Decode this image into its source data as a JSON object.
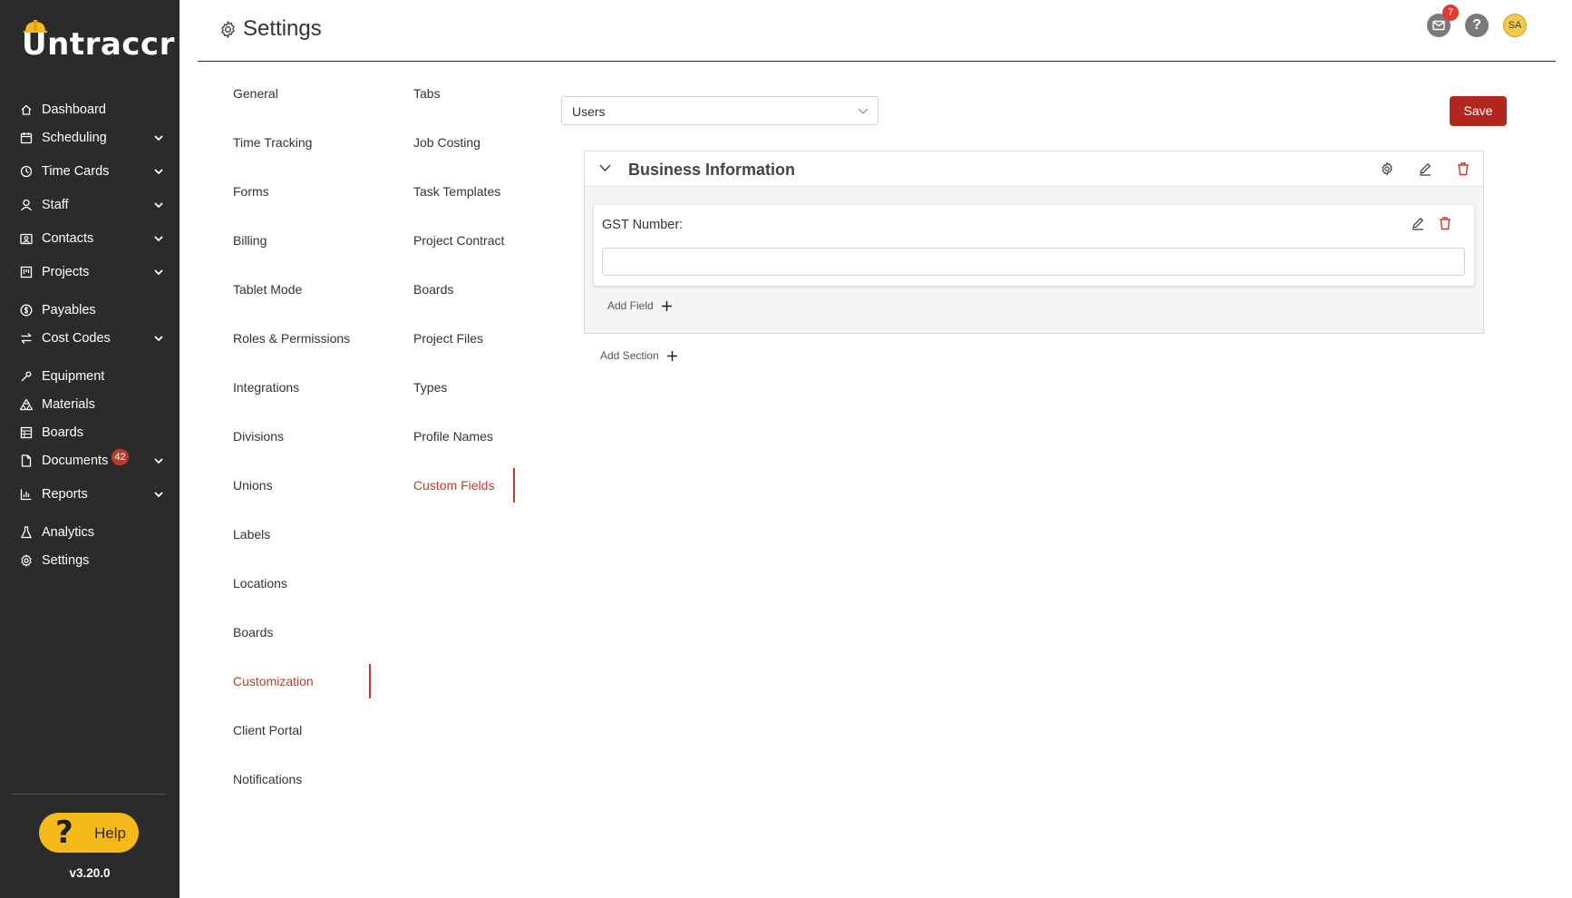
{
  "app": {
    "logo_text": "Untraccr",
    "version": "v3.20.0",
    "help_label": "Help"
  },
  "sidebar": {
    "items": [
      {
        "label": "Dashboard",
        "icon": "home-icon",
        "chevron": false
      },
      {
        "label": "Scheduling",
        "icon": "calendar-icon",
        "chevron": true
      },
      {
        "label": "Time Cards",
        "icon": "clock-icon",
        "chevron": true
      },
      {
        "label": "Staff",
        "icon": "user-icon",
        "chevron": true
      },
      {
        "label": "Contacts",
        "icon": "contacts-icon",
        "chevron": true
      },
      {
        "label": "Projects",
        "icon": "projects-icon",
        "chevron": true
      },
      {
        "label": "Payables",
        "icon": "dollar-icon",
        "chevron": false
      },
      {
        "label": "Cost Codes",
        "icon": "swap-icon",
        "chevron": true
      },
      {
        "label": "Equipment",
        "icon": "wrench-icon",
        "chevron": false
      },
      {
        "label": "Materials",
        "icon": "materials-icon",
        "chevron": false
      },
      {
        "label": "Boards",
        "icon": "board-icon",
        "chevron": false
      },
      {
        "label": "Documents",
        "icon": "document-icon",
        "chevron": true,
        "badge": "42"
      },
      {
        "label": "Reports",
        "icon": "bar-chart-icon",
        "chevron": true
      },
      {
        "label": "Analytics",
        "icon": "flask-icon",
        "chevron": false
      },
      {
        "label": "Settings",
        "icon": "gear-icon",
        "chevron": false
      }
    ]
  },
  "header": {
    "title": "Settings",
    "mail_badge": "7",
    "help_glyph": "?",
    "avatar_initials": "SA"
  },
  "settings_nav": {
    "column1": [
      "General",
      "Time Tracking",
      "Forms",
      "Billing",
      "Tablet Mode",
      "Roles & Permissions",
      "Integrations",
      "Divisions",
      "Unions",
      "Labels",
      "Locations",
      "Boards",
      "Customization",
      "Client Portal",
      "Notifications"
    ],
    "column1_active": "Customization",
    "column2": [
      "Tabs",
      "Job Costing",
      "Task Templates",
      "Project Contract",
      "Boards",
      "Project Files",
      "Types",
      "Profile Names",
      "Custom Fields"
    ],
    "column2_active": "Custom Fields"
  },
  "main": {
    "entity_select": {
      "value": "Users"
    },
    "save_label": "Save",
    "section": {
      "title": "Business Information",
      "field": {
        "label": "GST Number:",
        "value": ""
      },
      "add_field_label": "Add Field"
    },
    "add_section_label": "Add Section"
  },
  "colors": {
    "sidebar_bg": "#2b2b2b",
    "accent_red": "#c0392b",
    "help_yellow": "#f6b91a"
  }
}
